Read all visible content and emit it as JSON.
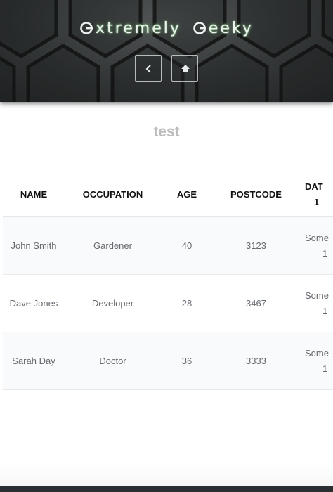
{
  "header": {
    "logo_first_word": "xtremely",
    "logo_second_word": "eeky",
    "back_button_icon": "chevron-left-icon",
    "home_button_icon": "home-icon"
  },
  "page": {
    "title": "test"
  },
  "table": {
    "columns": [
      "Name",
      "Occupation",
      "Age",
      "Postcode"
    ],
    "partial_column": {
      "line1": "DAT",
      "line2": "1"
    },
    "rows": [
      {
        "name": "John Smith",
        "occupation": "Gardener",
        "age": "40",
        "postcode": "3123",
        "date_line1": "Some",
        "date_line2": "1"
      },
      {
        "name": "Dave Jones",
        "occupation": "Developer",
        "age": "28",
        "postcode": "3467",
        "date_line1": "Some",
        "date_line2": "1"
      },
      {
        "name": "Sarah Day",
        "occupation": "Doctor",
        "age": "36",
        "postcode": "3333",
        "date_line1": "Some",
        "date_line2": "1"
      }
    ]
  },
  "colors": {
    "header_bg": "#2e3132",
    "title_gray": "#bdbdbd",
    "footer_bar": "#2b2e31",
    "logo_glow": "#9fdc9f"
  }
}
